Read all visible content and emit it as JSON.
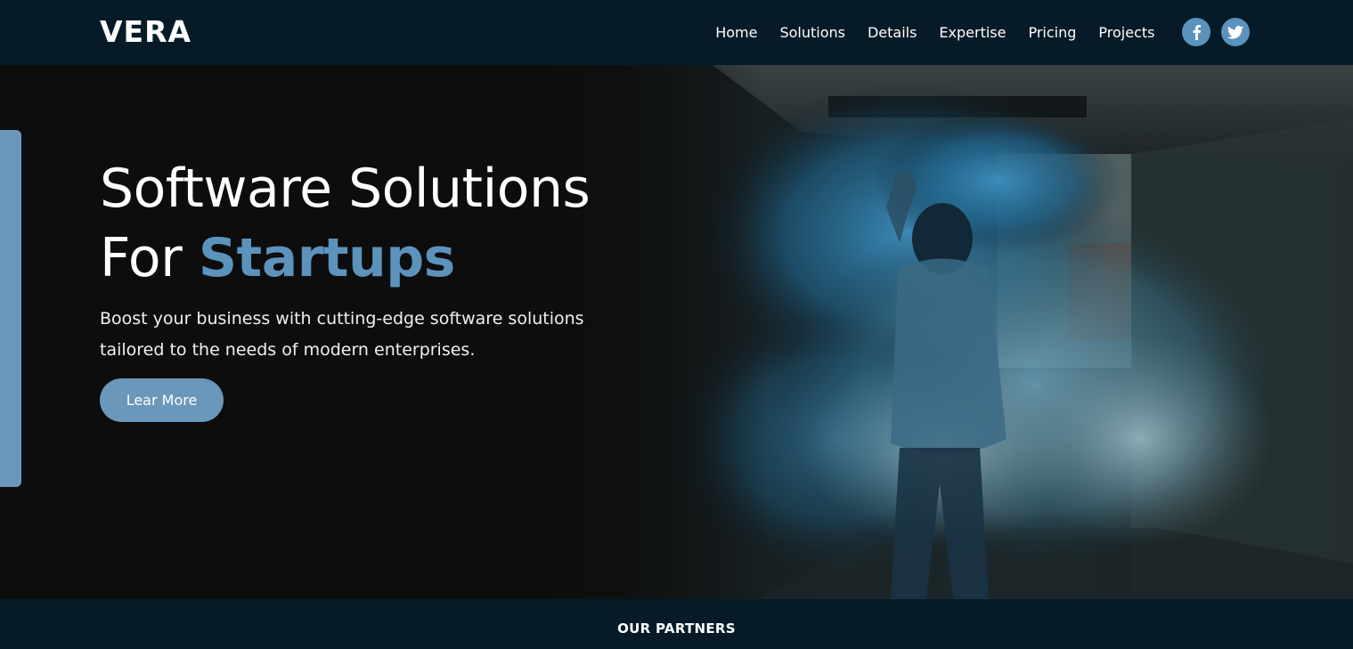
{
  "brand": {
    "logo_text": "VERA"
  },
  "nav": {
    "links": [
      "Home",
      "Solutions",
      "Details",
      "Expertise",
      "Pricing",
      "Projects"
    ],
    "social": [
      {
        "name": "facebook",
        "icon": "facebook-icon"
      },
      {
        "name": "twitter",
        "icon": "twitter-icon"
      }
    ]
  },
  "hero": {
    "title_line1": "Software Solutions",
    "title_line2_prefix": "For ",
    "title_line2_accent": "Startups",
    "subtitle": "Boost your business with cutting-edge software solutions tailored to the needs of modern enterprises.",
    "cta_label": "Lear More",
    "image_description_icon": "smoke-figure-photo"
  },
  "partners": {
    "title": "OUR PARTNERS"
  },
  "colors": {
    "nav_bg": "#061b27",
    "hero_bg": "#0d0d0d",
    "accent": "#5b93bd",
    "button": "#6b97ba"
  }
}
